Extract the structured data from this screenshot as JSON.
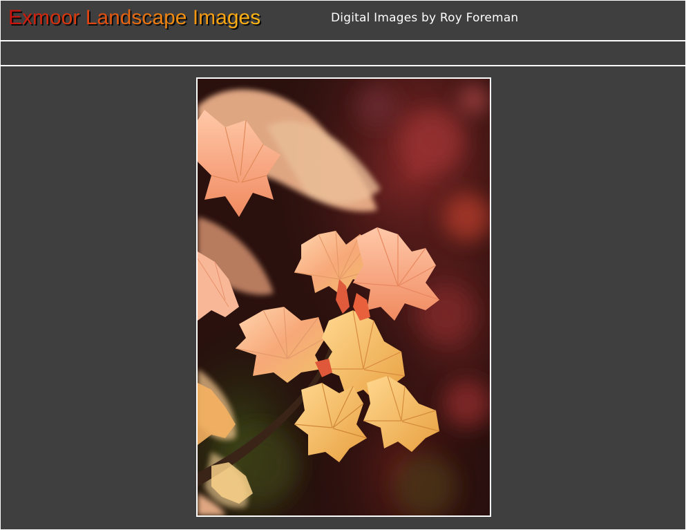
{
  "header": {
    "site_title": "Exmoor Landscape Images",
    "subtitle": "Digital Images by Roy Foreman"
  },
  "photo": {
    "subject": "autumn-leaves-photo"
  },
  "colors": {
    "page_background": "#3f3f3f",
    "rule": "#ffffff",
    "title_gradient_start": "#c8100c",
    "title_gradient_end": "#ffb814",
    "subtitle": "#ffffff"
  }
}
